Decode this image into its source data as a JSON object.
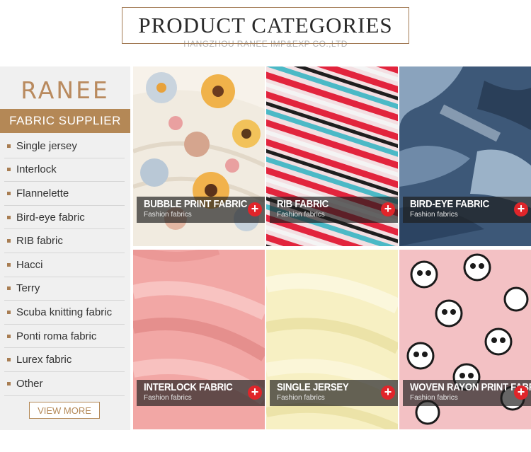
{
  "header": {
    "title": "PRODUCT CATEGORIES",
    "subtitle": "HANGZHOU RANEE IMP&EXP CO.,LTD"
  },
  "sidebar": {
    "logo": "RANEE",
    "heading": "FABRIC SUPPLIER",
    "items": [
      "Single jersey",
      "Interlock",
      "Flannelette",
      "Bird-eye fabric",
      "RIB fabric",
      "Hacci",
      "Terry",
      "Scuba knitting fabric",
      "Ponti roma fabric",
      "Lurex fabric",
      "Other"
    ],
    "view_more": "VIEW MORE"
  },
  "products": [
    {
      "title": "BUBBLE PRINT FABRIC",
      "subtitle": "Fashion fabrics",
      "icon": "plus-icon"
    },
    {
      "title": "RIB FABRIC",
      "subtitle": "Fashion fabrics",
      "icon": "plus-icon"
    },
    {
      "title": "BIRD-EYE FABRIC",
      "subtitle": "Fashion fabrics",
      "icon": "plus-icon"
    },
    {
      "title": "INTERLOCK FABRIC",
      "subtitle": "Fashion fabrics",
      "icon": "plus-icon"
    },
    {
      "title": "SINGLE JERSEY",
      "subtitle": "Fashion fabrics",
      "icon": "plus-icon"
    },
    {
      "title": "WOVEN RAYON PRINT FABRIC",
      "subtitle": "Fashion fabrics",
      "icon": "plus-icon"
    }
  ],
  "colors": {
    "accent": "#b48856",
    "plus_button": "#e0252a"
  }
}
